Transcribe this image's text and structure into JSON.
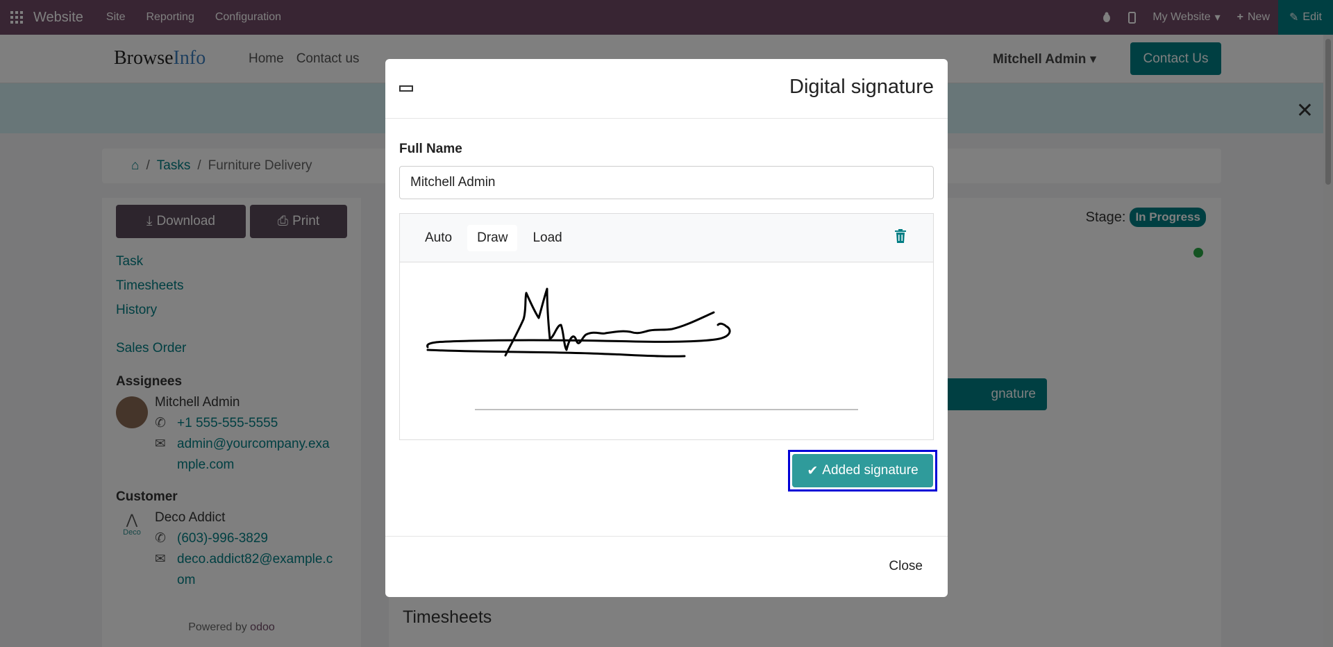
{
  "topbar": {
    "brand": "Website",
    "menu": [
      "Site",
      "Reporting",
      "Configuration"
    ],
    "my_website": "My Website",
    "new_label": "New",
    "edit_label": "Edit"
  },
  "header": {
    "logo_part1": "Browse",
    "logo_part2": "Info",
    "nav": [
      "Home",
      "Contact us"
    ],
    "user": "Mitchell Admin",
    "contact_button": "Contact Us"
  },
  "breadcrumb": {
    "sep": "/",
    "tasks": "Tasks",
    "current": "Furniture Delivery"
  },
  "sidebar": {
    "download": "Download",
    "print": "Print",
    "links": [
      "Task",
      "Timesheets",
      "History"
    ],
    "sales_order": "Sales Order",
    "assignees_title": "Assignees",
    "assignee_name": "Mitchell Admin",
    "assignee_phone": "+1 555-555-5555",
    "assignee_email_1": "admin@yourcompany.exa",
    "assignee_email_2": "mple.com",
    "customer_title": "Customer",
    "customer_name": "Deco Addict",
    "customer_phone": "(603)-996-3829",
    "customer_email_1": "deco.addict82@example.c",
    "customer_email_2": "om",
    "customer_logo_text": "Deco",
    "powered_by": "Powered by",
    "odoo": "odoo"
  },
  "main": {
    "stage_label": "Stage:",
    "stage_value": "In Progress",
    "bg_button": "gnature",
    "timesheets": "Timesheets"
  },
  "modal": {
    "title": "Digital signature",
    "full_name_label": "Full Name",
    "full_name_value": "Mitchell Admin",
    "tabs": [
      "Auto",
      "Draw",
      "Load"
    ],
    "active_tab": "Draw",
    "submit": "Added signature",
    "close": "Close"
  },
  "colors": {
    "topbar": "#714b67",
    "accent": "#017e84",
    "highlight_outline": "#0000d6"
  }
}
